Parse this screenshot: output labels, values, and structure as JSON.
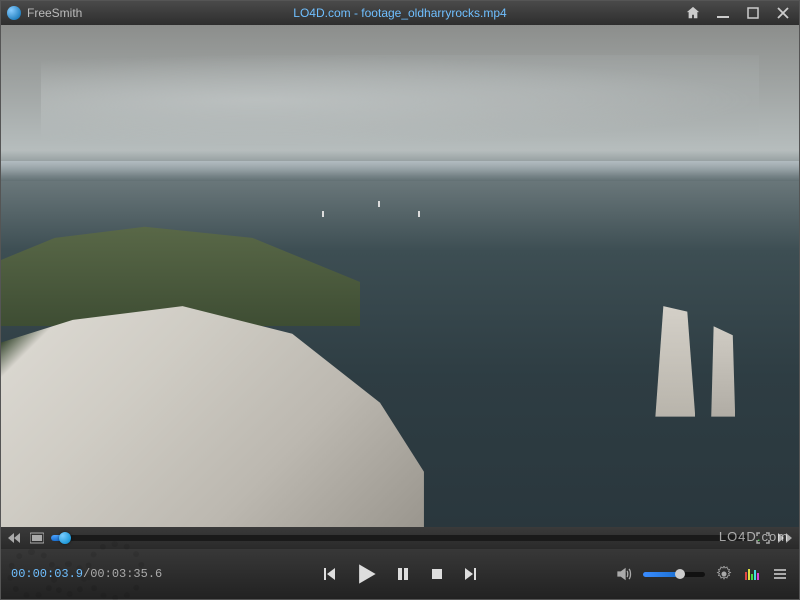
{
  "titlebar": {
    "app_name": "FreeSmith",
    "file_title": "LO4D.com - footage_oldharryrocks.mp4"
  },
  "playback": {
    "current_time": "00:00:03.9",
    "duration": "00:03:35.6",
    "progress_pct": 2,
    "volume_pct": 60
  },
  "watermark": {
    "prefix": "LO4D",
    "suffix": "com"
  },
  "icons": {
    "home": "home-icon",
    "minimize": "minimize-icon",
    "maximize": "maximize-icon",
    "close": "close-icon",
    "rewind": "rewind-icon",
    "video": "video-icon",
    "fullscreen": "fullscreen-icon",
    "prev": "previous-icon",
    "play": "play-icon",
    "pause": "pause-icon",
    "stop": "stop-icon",
    "next": "next-icon",
    "volume": "volume-icon",
    "settings": "settings-icon",
    "equalizer": "equalizer-icon",
    "playlist": "playlist-icon"
  }
}
